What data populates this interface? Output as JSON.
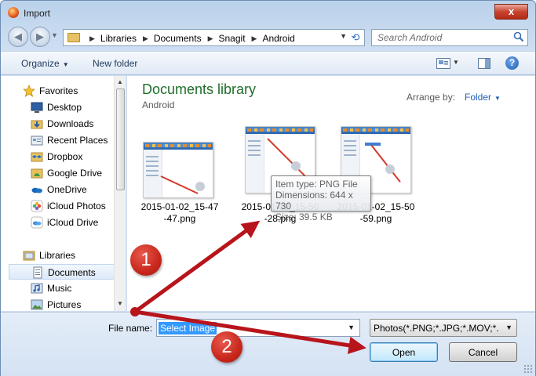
{
  "window": {
    "title": "Import",
    "close_glyph": "x",
    "icon": "app-icon"
  },
  "nav": {
    "back_glyph": "◀",
    "forward_glyph": "▶",
    "breadcrumbs": [
      "Libraries",
      "Documents",
      "Snagit",
      "Android"
    ],
    "search_placeholder": "Search Android"
  },
  "toolbar": {
    "organize_label": "Organize",
    "new_folder_label": "New folder",
    "help_glyph": "?"
  },
  "sidebar": {
    "favorites_header": "Favorites",
    "favorites": [
      {
        "label": "Desktop",
        "icon": "desktop-icon"
      },
      {
        "label": "Downloads",
        "icon": "downloads-folder-icon"
      },
      {
        "label": "Recent Places",
        "icon": "recent-places-icon"
      },
      {
        "label": "Dropbox",
        "icon": "dropbox-icon"
      },
      {
        "label": "Google Drive",
        "icon": "google-drive-icon"
      },
      {
        "label": "OneDrive",
        "icon": "onedrive-icon"
      },
      {
        "label": "iCloud Photos",
        "icon": "icloud-photos-icon"
      },
      {
        "label": "iCloud Drive",
        "icon": "icloud-drive-icon"
      }
    ],
    "libraries_header": "Libraries",
    "libraries": [
      {
        "label": "Documents",
        "icon": "documents-icon",
        "selected": true
      },
      {
        "label": "Music",
        "icon": "music-icon",
        "selected": false
      },
      {
        "label": "Pictures",
        "icon": "pictures-icon",
        "selected": false
      }
    ]
  },
  "content": {
    "library_title": "Documents library",
    "library_subtitle": "Android",
    "arrange_label": "Arrange by:",
    "arrange_value": "Folder",
    "files": [
      {
        "line1": "2015-01-02_15-47",
        "line2": "-47.png"
      },
      {
        "line1": "2015-01-02_15-50",
        "line2": "-28.png"
      },
      {
        "line1": "2015-01-02_15-50",
        "line2": "-59.png"
      }
    ],
    "tooltip": {
      "type": "Item type: PNG File",
      "dimensions": "Dimensions: 644 x 730",
      "size": "Size: 39.5 KB"
    }
  },
  "footer": {
    "file_name_label": "File name:",
    "file_name_value": "Select Image",
    "file_type_value": "Photos(*.PNG;*.JPG;*.MOV;*.M",
    "open_label": "Open",
    "cancel_label": "Cancel"
  },
  "annotations": {
    "step1": "1",
    "step2": "2",
    "arrow_color": "#b8141c",
    "badge_color": "#c8271c"
  },
  "colors": {
    "library_title": "#1e6f2b",
    "link": "#2061b5",
    "selection": "#3399ff"
  }
}
